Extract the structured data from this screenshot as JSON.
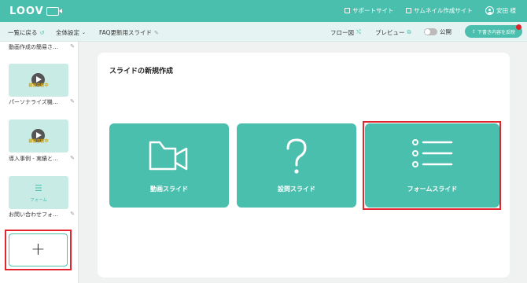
{
  "app": {
    "logo_text": "LOOV"
  },
  "header": {
    "support": "サポートサイト",
    "thumbnail_site": "サムネイル作成サイト",
    "user": "安田 様"
  },
  "toolbar": {
    "back": "一覧に戻る",
    "settings": "全体設定",
    "doc_title": "FAQ更新用スライド",
    "flow": "フロー図",
    "preview": "プレビュー",
    "publish_label": "公開",
    "publish_toggle_on": false,
    "reflect_button": "下書き内容を反映"
  },
  "sidebar": {
    "items": [
      {
        "caption": "動画作成の簡易さ…"
      },
      {
        "thumb_text": "録音中前中",
        "caption": "パーソナライズ機…"
      },
      {
        "thumb_text": "録音中前中",
        "caption": "導入事例 - 実績と…"
      },
      {
        "thumb_text": "フォーム",
        "caption": "お問い合わせフォ…"
      }
    ],
    "add_symbol": "+"
  },
  "main": {
    "title": "スライドの新規作成",
    "cards": [
      {
        "label": "動画スライド",
        "icon": "video-camera-icon"
      },
      {
        "label": "設問スライド",
        "icon": "question-mark-icon"
      },
      {
        "label": "フォームスライド",
        "icon": "list-icon"
      }
    ]
  },
  "colors": {
    "accent": "#4bbfae",
    "highlight": "#e3262e"
  }
}
